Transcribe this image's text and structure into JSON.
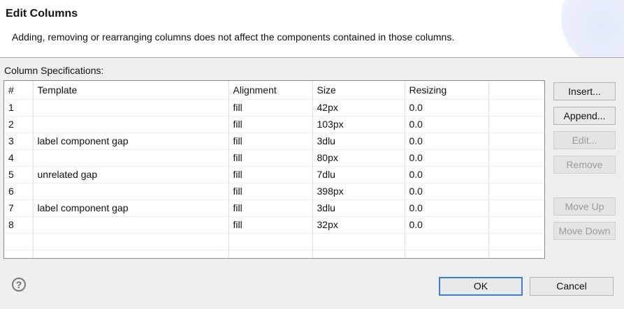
{
  "dialog": {
    "title": "Edit Columns",
    "description": "Adding, removing or rearranging columns does not affect the components contained in those columns."
  },
  "section_label": "Column Specifications:",
  "table": {
    "headers": [
      "#",
      "Template",
      "Alignment",
      "Size",
      "Resizing"
    ],
    "rows": [
      [
        "1",
        "",
        "fill",
        "42px",
        "0.0"
      ],
      [
        "2",
        "",
        "fill",
        "103px",
        "0.0"
      ],
      [
        "3",
        "label component gap",
        "fill",
        "3dlu",
        "0.0"
      ],
      [
        "4",
        "",
        "fill",
        "80px",
        "0.0"
      ],
      [
        "5",
        "unrelated gap",
        "fill",
        "7dlu",
        "0.0"
      ],
      [
        "6",
        "",
        "fill",
        "398px",
        "0.0"
      ],
      [
        "7",
        "label component gap",
        "fill",
        "3dlu",
        "0.0"
      ],
      [
        "8",
        "",
        "fill",
        "32px",
        "0.0"
      ]
    ]
  },
  "buttons": {
    "insert": "Insert...",
    "append": "Append...",
    "edit": "Edit...",
    "remove": "Remove",
    "move_up": "Move Up",
    "move_down": "Move Down",
    "ok": "OK",
    "cancel": "Cancel"
  },
  "help_icon": "?",
  "colors": {
    "default_button_border": "#3b7fd2",
    "disabled_text": "#9a9a9a"
  }
}
